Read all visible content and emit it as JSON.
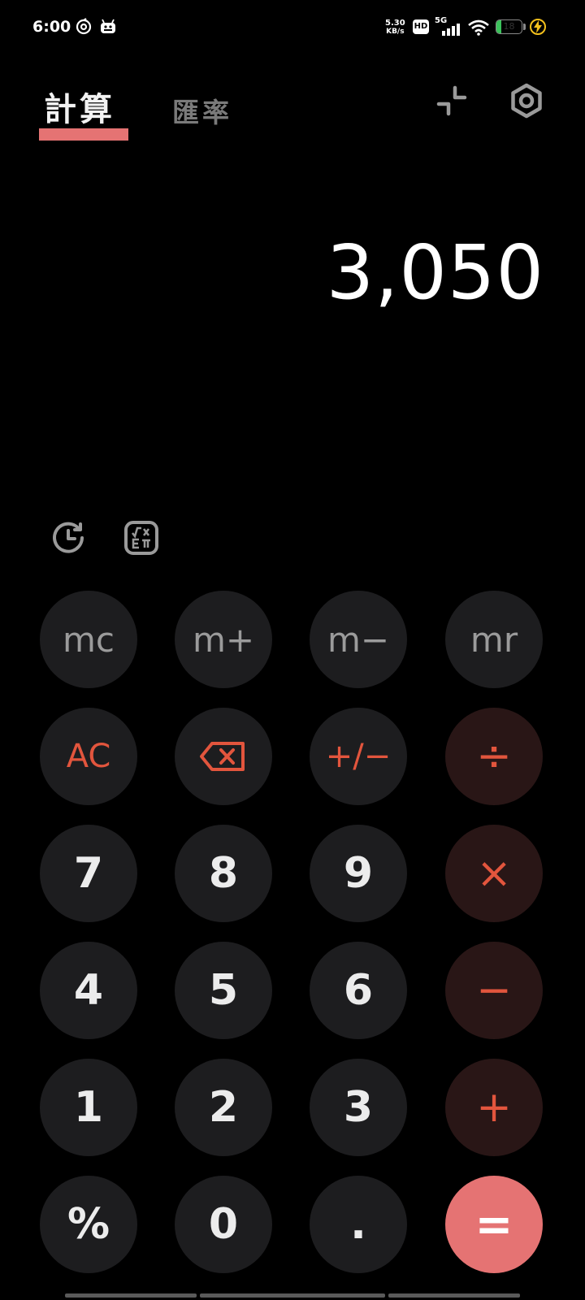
{
  "status_bar": {
    "time": "6:00",
    "net_speed_value": "5.30",
    "net_speed_unit": "KB/s",
    "hd_label": "HD",
    "network_label": "5G",
    "battery_level": "18",
    "battery_fraction": 0.18,
    "battery_fill_color": "#3bc25b",
    "icons": [
      "hotspot-icon",
      "android-icon",
      "signal-icon",
      "wifi-icon",
      "battery-icon",
      "charging-icon"
    ]
  },
  "tabs": {
    "calculate": "計算",
    "exchange_rate": "匯率",
    "active": "calculate",
    "accent_color": "#e57373"
  },
  "header_icons": [
    "collapse-icon",
    "settings-icon"
  ],
  "display": {
    "value": "3,050"
  },
  "tools": [
    "history-icon",
    "scientific-icon"
  ],
  "keypad": {
    "mc": "mc",
    "m_plus": "m+",
    "m_minus": "m−",
    "mr": "mr",
    "ac": "AC",
    "backspace_icon": "backspace-icon",
    "plus_minus": "+/−",
    "divide": "÷",
    "seven": "7",
    "eight": "8",
    "nine": "9",
    "multiply": "×",
    "four": "4",
    "five": "5",
    "six": "6",
    "minus": "−",
    "one": "1",
    "two": "2",
    "three": "3",
    "plus": "+",
    "percent": "%",
    "zero": "0",
    "decimal": ".",
    "equals": "=",
    "operator_color": "#e2553d",
    "equals_color": "#e57373"
  }
}
